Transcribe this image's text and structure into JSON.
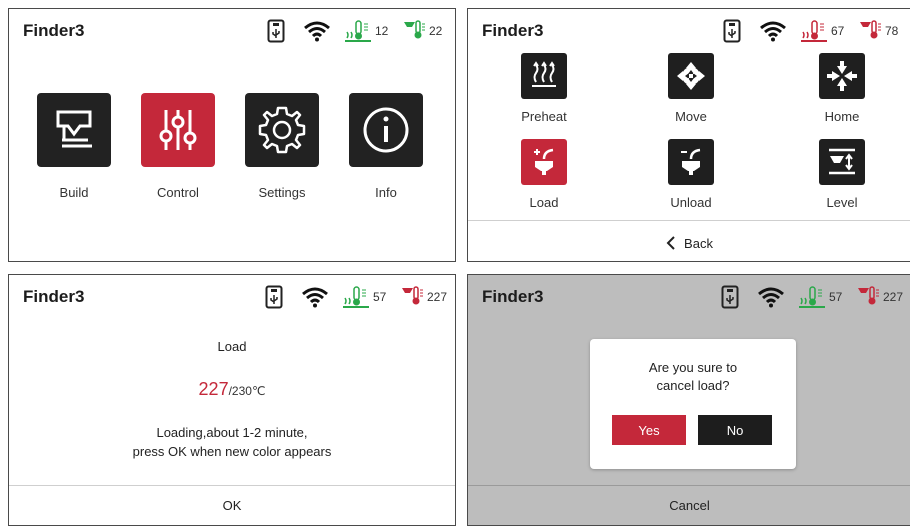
{
  "app_title": "Finder3",
  "panels": [
    {
      "status": {
        "bed_temp": "12",
        "nozzle_temp": "22",
        "bed_color": "#2aa84a",
        "nozzle_color": "#2aa84a"
      },
      "menu": [
        {
          "label": "Build",
          "icon": "build-icon",
          "highlight": false
        },
        {
          "label": "Control",
          "icon": "sliders-icon",
          "highlight": true
        },
        {
          "label": "Settings",
          "icon": "gear-icon",
          "highlight": false
        },
        {
          "label": "Info",
          "icon": "info-icon",
          "highlight": false
        }
      ]
    },
    {
      "status": {
        "bed_temp": "67",
        "nozzle_temp": "78",
        "bed_color": "#c4283a",
        "nozzle_color": "#c4283a"
      },
      "controls": [
        {
          "label": "Preheat",
          "icon": "preheat-icon",
          "highlight": false
        },
        {
          "label": "Move",
          "icon": "move-icon",
          "highlight": false
        },
        {
          "label": "Home",
          "icon": "home-icon",
          "highlight": false
        },
        {
          "label": "Load",
          "icon": "load-icon",
          "highlight": true
        },
        {
          "label": "Unload",
          "icon": "unload-icon",
          "highlight": false
        },
        {
          "label": "Level",
          "icon": "level-icon",
          "highlight": false
        }
      ],
      "back_label": "Back"
    },
    {
      "status": {
        "bed_temp": "57",
        "nozzle_temp": "227",
        "bed_color": "#2aa84a",
        "nozzle_color": "#c4283a"
      },
      "heading": "Load",
      "current_temp": "227",
      "target_temp": "/230℃",
      "message_line1": "Loading,about 1-2 minute,",
      "message_line2": "press OK when new color appears",
      "ok_label": "OK"
    },
    {
      "status": {
        "bed_temp": "57",
        "nozzle_temp": "227",
        "bed_color": "#2aa84a",
        "nozzle_color": "#c4283a"
      },
      "dialog": {
        "line1": "Are you sure to",
        "line2": "cancel load?",
        "yes_label": "Yes",
        "no_label": "No"
      },
      "cancel_label": "Cancel"
    }
  ]
}
